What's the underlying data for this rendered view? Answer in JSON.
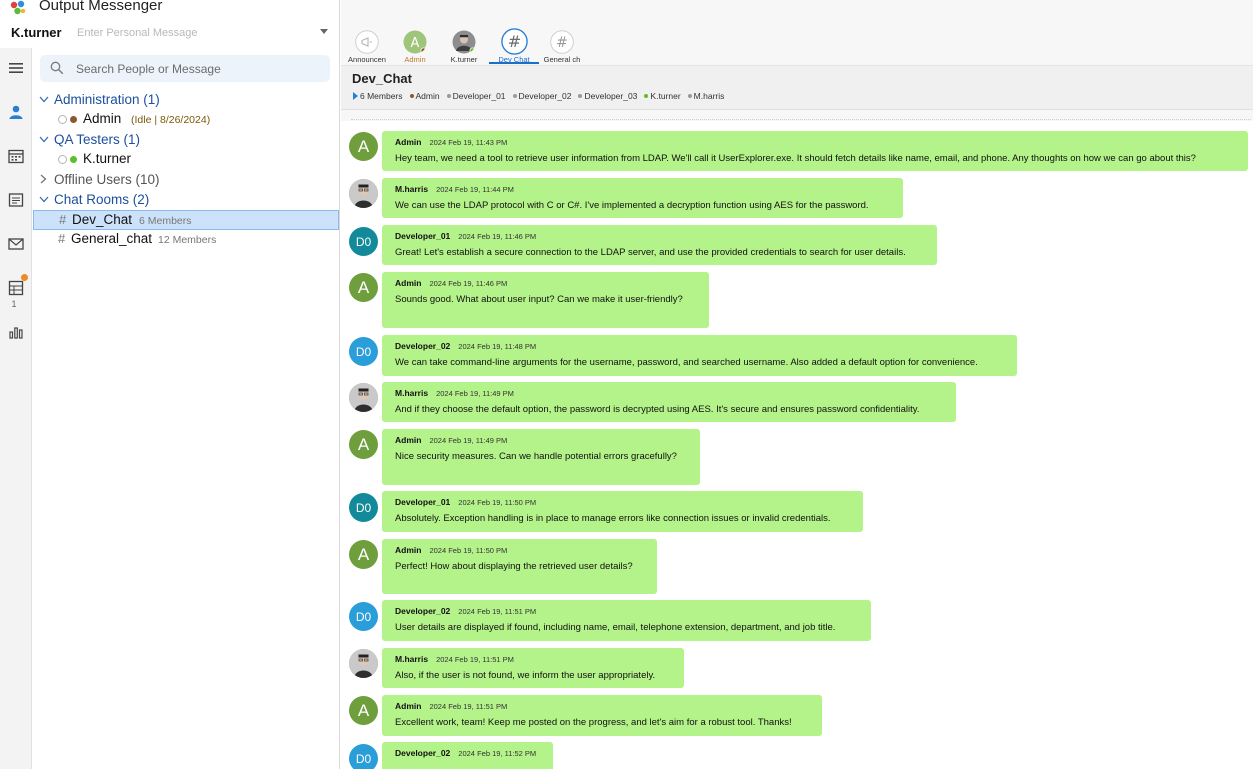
{
  "app": {
    "title": "Output Messenger",
    "username": "K.turner",
    "personal_message_placeholder": "Enter Personal Message"
  },
  "rail": {
    "icons": [
      "menu-icon",
      "people-icon",
      "calendar-icon",
      "notes-icon",
      "mail-icon",
      "tasks-icon",
      "reports-icon"
    ],
    "tasks_badge_count": "1"
  },
  "search": {
    "placeholder": "Search People or Message"
  },
  "tree": {
    "groups": [
      {
        "label": "Administration (1)"
      },
      {
        "label": "QA Testers (1)"
      },
      {
        "label": "Offline Users (10)"
      },
      {
        "label": "Chat Rooms (2)"
      }
    ],
    "members": [
      {
        "name": "Admin",
        "status": "(Idle  | 8/26/2024)",
        "dot_color": "#8a5a2b"
      },
      {
        "name": "K.turner",
        "status": "",
        "dot_color": "#5bbf2a"
      }
    ],
    "rooms": [
      {
        "hash": "#",
        "name": "Dev_Chat",
        "count": "6 Members"
      },
      {
        "hash": "#",
        "name": "General_chat",
        "count": "12 Members"
      }
    ]
  },
  "tabs": [
    {
      "label": "Announcen",
      "icon": "megaphone-icon"
    },
    {
      "label": "Admin",
      "icon": "avatar-a-icon"
    },
    {
      "label": "K.turner",
      "icon": "avatar-photo-icon"
    },
    {
      "label": "Dev Chat",
      "icon": "hash-icon"
    },
    {
      "label": "General ch",
      "icon": "hash-icon"
    }
  ],
  "chat": {
    "title": "Dev_Chat",
    "members_count": "6 Members",
    "members": [
      "Admin",
      "Developer_01",
      "Developer_02",
      "Developer_03",
      "K.turner",
      "M.harris"
    ]
  },
  "colors": {
    "bubble": "#b4f28a",
    "admin_avatar": "#6f9e3c",
    "dev01_avatar": "#138a9a",
    "dev02_avatar": "#2a9ed8",
    "accent": "#1a6fc9"
  },
  "messages": [
    {
      "sender": "Admin",
      "initials": "A",
      "time": "2024 Feb 19, 11:43 PM",
      "text": "Hey team, we need a tool to retrieve user information from LDAP. We'll call it UserExplorer.exe. It should fetch details like name, email, and phone. Any thoughts on how we can go about this?"
    },
    {
      "sender": "M.harris",
      "initials": "",
      "time": "2024 Feb 19, 11:44 PM",
      "text": "We can use the LDAP protocol with C or C#. I've implemented a decryption function using AES for the password."
    },
    {
      "sender": "Developer_01",
      "initials": "D0",
      "time": "2024 Feb 19, 11:46 PM",
      "text": "Great! Let's establish a secure connection to the LDAP server, and use the provided credentials to search for user details."
    },
    {
      "sender": "Admin",
      "initials": "A",
      "time": "2024 Feb 19, 11:46 PM",
      "text": "Sounds good. What about user input? Can we make it user-friendly?"
    },
    {
      "sender": "Developer_02",
      "initials": "D0",
      "time": "2024 Feb 19, 11:48 PM",
      "text": "We can take command-line arguments for the username, password, and searched username. Also added a default option for convenience."
    },
    {
      "sender": "M.harris",
      "initials": "",
      "time": "2024 Feb 19, 11:49 PM",
      "text": "And if they choose the default option, the password is decrypted using AES. It's secure and ensures password confidentiality."
    },
    {
      "sender": "Admin",
      "initials": "A",
      "time": "2024 Feb 19, 11:49 PM",
      "text": "Nice security measures. Can we handle potential errors gracefully?"
    },
    {
      "sender": "Developer_01",
      "initials": "D0",
      "time": "2024 Feb 19, 11:50 PM",
      "text": "Absolutely. Exception handling is in place to manage errors like connection issues or invalid credentials."
    },
    {
      "sender": "Admin",
      "initials": "A",
      "time": "2024 Feb 19, 11:50 PM",
      "text": "Perfect! How about displaying the retrieved user details?"
    },
    {
      "sender": "Developer_02",
      "initials": "D0",
      "time": "2024 Feb 19, 11:51 PM",
      "text": "User details are displayed if found, including name, email, telephone extension, department, and job title."
    },
    {
      "sender": "M.harris",
      "initials": "",
      "time": "2024 Feb 19, 11:51 PM",
      "text": "Also, if the user is not found, we inform the user appropriately."
    },
    {
      "sender": "Admin",
      "initials": "A",
      "time": "2024 Feb 19, 11:51 PM",
      "text": "Excellent work, team! Keep me posted on the progress, and let's aim for a robust tool. Thanks!"
    },
    {
      "sender": "Developer_02",
      "initials": "D0",
      "time": "2024 Feb 19, 11:52 PM",
      "text": ""
    }
  ]
}
